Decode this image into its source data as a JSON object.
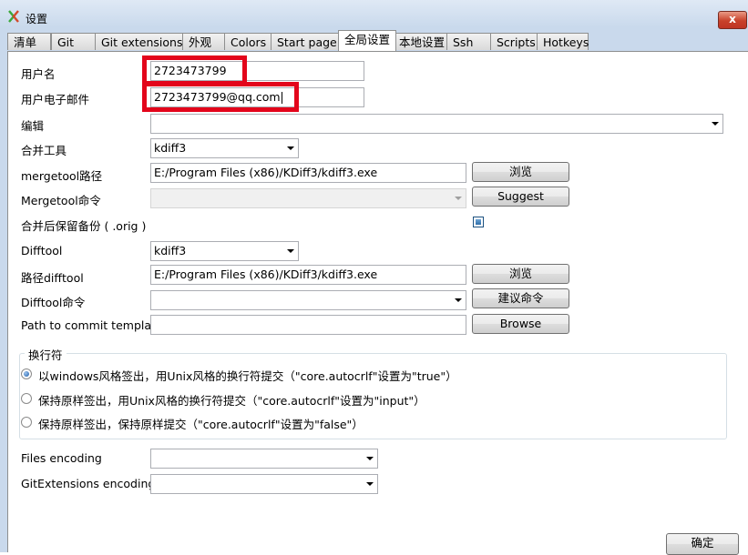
{
  "window": {
    "title": "设置",
    "close_label": "x"
  },
  "tabs": [
    {
      "label": "清单"
    },
    {
      "label": "Git"
    },
    {
      "label": "Git extensions"
    },
    {
      "label": "外观"
    },
    {
      "label": "Colors"
    },
    {
      "label": "Start page"
    },
    {
      "label": "全局设置",
      "active": true
    },
    {
      "label": "本地设置"
    },
    {
      "label": "Ssh"
    },
    {
      "label": "Scripts"
    },
    {
      "label": "Hotkeys"
    }
  ],
  "form": {
    "username_label": "用户名",
    "username_value": "2723473799",
    "email_label": "用户电子邮件",
    "email_value": "2723473799@qq.com",
    "editor_label": "编辑",
    "editor_value": "",
    "mergetool_label": "合并工具",
    "mergetool_value": "kdiff3",
    "mergetool_path_label": "mergetool路径",
    "mergetool_path_value": "E:/Program Files (x86)/KDiff3/kdiff3.exe",
    "browse_label_1": "浏览",
    "mergetool_cmd_label": "Mergetool命令",
    "mergetool_cmd_value": "",
    "suggest_label": "Suggest",
    "keep_backup_label": "合并后保留备份 ( .orig )",
    "keep_backup_checked": true,
    "difftool_label": "Difftool",
    "difftool_value": "kdiff3",
    "difftool_path_label": "路径difftool",
    "difftool_path_value": "E:/Program Files (x86)/KDiff3/kdiff3.exe",
    "browse_label_2": "浏览",
    "difftool_cmd_label": "Difftool命令",
    "difftool_cmd_value": "",
    "suggest_cmd_label": "建议命令",
    "commit_template_label": "Path to commit template",
    "commit_template_value": "",
    "browse_label_3": "Browse"
  },
  "line_endings": {
    "title": "换行符",
    "options": [
      {
        "label": "以windows风格签出，用Unix风格的换行符提交（\"core.autocrlf\"设置为\"true\"）",
        "selected": true
      },
      {
        "label": "保持原样签出，用Unix风格的换行符提交（\"core.autocrlf\"设置为\"input\"）",
        "selected": false
      },
      {
        "label": "保持原样签出，保持原样提交（\"core.autocrlf\"设置为\"false\"）",
        "selected": false
      }
    ]
  },
  "encoding": {
    "files_label": "Files encoding",
    "files_value": "",
    "gitext_label": "GitExtensions encoding",
    "gitext_value": ""
  },
  "footer": {
    "ok_label": "确定"
  },
  "colors": {
    "highlight": "#e3051b",
    "accent": "#2e6ea8"
  }
}
